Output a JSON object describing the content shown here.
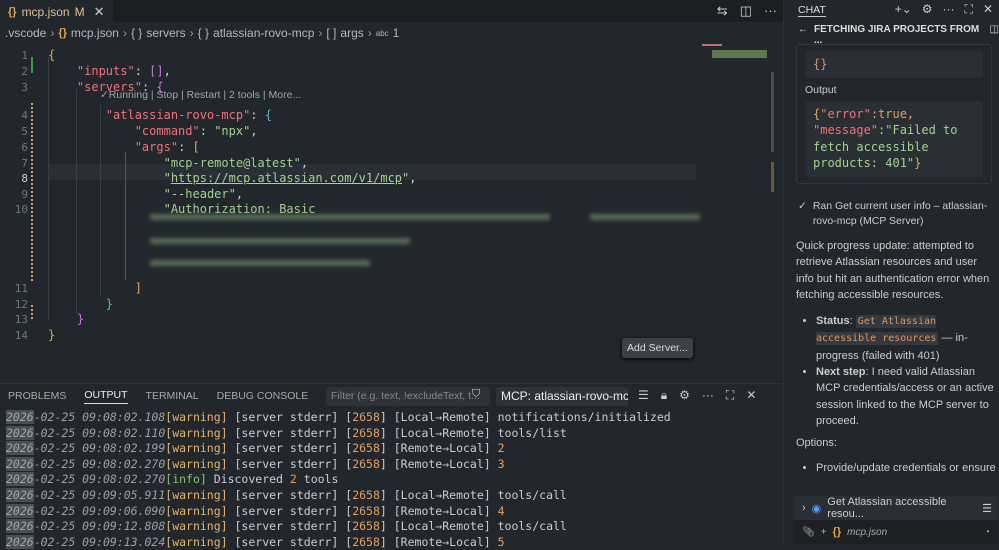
{
  "editor": {
    "tab": {
      "name": "mcp.json",
      "status": "M"
    },
    "breadcrumb": [
      ".vscode",
      "mcp.json",
      "servers",
      "atlassian-rovo-mcp",
      "args",
      "1"
    ],
    "codelens": "✓Running | Stop | Restart | 2 tools | More...",
    "lines": [
      {
        "n": "1",
        "tokens": [
          {
            "t": "{",
            "c": "b1"
          }
        ]
      },
      {
        "n": "2",
        "tokens": [
          {
            "t": "    "
          },
          {
            "t": "\"inputs\"",
            "c": "k"
          },
          {
            "t": ": ",
            "c": "p"
          },
          {
            "t": "[]",
            "c": "b2"
          },
          {
            "t": ",",
            "c": "p"
          }
        ]
      },
      {
        "n": "3",
        "tokens": [
          {
            "t": "    "
          },
          {
            "t": "\"servers\"",
            "c": "k"
          },
          {
            "t": ": ",
            "c": "p"
          },
          {
            "t": "{",
            "c": "b2"
          }
        ]
      },
      {
        "n": "4",
        "tokens": [
          {
            "t": "        "
          },
          {
            "t": "\"atlassian-rovo-mcp\"",
            "c": "k"
          },
          {
            "t": ": ",
            "c": "p"
          },
          {
            "t": "{",
            "c": "b3"
          }
        ]
      },
      {
        "n": "5",
        "tokens": [
          {
            "t": "            "
          },
          {
            "t": "\"command\"",
            "c": "k"
          },
          {
            "t": ": ",
            "c": "p"
          },
          {
            "t": "\"npx\"",
            "c": "s"
          },
          {
            "t": ",",
            "c": "p"
          }
        ]
      },
      {
        "n": "6",
        "tokens": [
          {
            "t": "            "
          },
          {
            "t": "\"args\"",
            "c": "k"
          },
          {
            "t": ": ",
            "c": "p"
          },
          {
            "t": "[",
            "c": "b1"
          }
        ]
      },
      {
        "n": "7",
        "tokens": [
          {
            "t": "                "
          },
          {
            "t": "\"mcp-remote@latest\"",
            "c": "s"
          },
          {
            "t": ",",
            "c": "p"
          }
        ]
      },
      {
        "n": "8",
        "tokens": [
          {
            "t": "                "
          },
          {
            "t": "\"",
            "c": "s"
          },
          {
            "t": "https://mcp.atlassian.com/v1/mcp",
            "c": "u"
          },
          {
            "t": "\"",
            "c": "s"
          },
          {
            "t": ",",
            "c": "p"
          }
        ]
      },
      {
        "n": "9",
        "tokens": [
          {
            "t": "                "
          },
          {
            "t": "\"--header\"",
            "c": "s"
          },
          {
            "t": ",",
            "c": "p"
          }
        ]
      },
      {
        "n": "10",
        "tokens": [
          {
            "t": "                "
          },
          {
            "t": "\"Authorization: Basic",
            "c": "s"
          }
        ]
      },
      {
        "n": "11",
        "tokens": [
          {
            "t": "            "
          },
          {
            "t": "]",
            "c": "b1"
          }
        ]
      },
      {
        "n": "12",
        "tokens": [
          {
            "t": "        "
          },
          {
            "t": "}",
            "c": "b3"
          }
        ]
      },
      {
        "n": "13",
        "tokens": [
          {
            "t": "    "
          },
          {
            "t": "}",
            "c": "b2"
          }
        ]
      },
      {
        "n": "14",
        "tokens": [
          {
            "t": "}",
            "c": "b1"
          }
        ]
      }
    ],
    "add_server": "Add Server..."
  },
  "panel": {
    "tabs": [
      "PROBLEMS",
      "OUTPUT",
      "TERMINAL",
      "DEBUG CONSOLE"
    ],
    "active_tab": "OUTPUT",
    "filter_placeholder": "Filter (e.g. text, !excludeText, t...",
    "channel": "MCP: atlassian-rovo-mcp",
    "log": [
      {
        "year": "2026",
        "ts": "-02-25 09:08:02.108",
        "lvl": "[warning]",
        "src": " [server stderr] [",
        "pid": "2658",
        "dir": "] [Local→Remote] ",
        "msg": "notifications/initialized"
      },
      {
        "year": "2026",
        "ts": "-02-25 09:08:02.110",
        "lvl": "[warning]",
        "src": " [server stderr] [",
        "pid": "2658",
        "dir": "] [Local→Remote] ",
        "msg": "tools/list"
      },
      {
        "year": "2026",
        "ts": "-02-25 09:08:02.199",
        "lvl": "[warning]",
        "src": " [server stderr] [",
        "pid": "2658",
        "dir": "] [Remote→Local] ",
        "msg": "2"
      },
      {
        "year": "2026",
        "ts": "-02-25 09:08:02.270",
        "lvl": "[warning]",
        "src": " [server stderr] [",
        "pid": "2658",
        "dir": "] [Remote→Local] ",
        "msg": "3"
      },
      {
        "year": "2026",
        "ts": "-02-25 09:08:02.270",
        "lvl": "[info]",
        "src": " Discovered ",
        "pid": "2",
        "dir": " tools",
        "msg": ""
      },
      {
        "year": "2026",
        "ts": "-02-25 09:09:05.911",
        "lvl": "[warning]",
        "src": " [server stderr] [",
        "pid": "2658",
        "dir": "] [Local→Remote] ",
        "msg": "tools/call"
      },
      {
        "year": "2026",
        "ts": "-02-25 09:09:06.090",
        "lvl": "[warning]",
        "src": " [server stderr] [",
        "pid": "2658",
        "dir": "] [Remote→Local] ",
        "msg": "4"
      },
      {
        "year": "2026",
        "ts": "-02-25 09:09:12.808",
        "lvl": "[warning]",
        "src": " [server stderr] [",
        "pid": "2658",
        "dir": "] [Local→Remote] ",
        "msg": "tools/call"
      },
      {
        "year": "2026",
        "ts": "-02-25 09:09:13.024",
        "lvl": "[warning]",
        "src": " [server stderr] [",
        "pid": "2658",
        "dir": "] [Remote→Local] ",
        "msg": "5"
      }
    ]
  },
  "chat": {
    "header": "CHAT",
    "conversation_title": "FETCHING JIRA PROJECTS FROM ...",
    "input_block": "{}",
    "output_label": "Output",
    "output": {
      "k1": "\"error\"",
      "v1": ":true,",
      "k2": "\"message\"",
      "v2": ":\"Failed to fetch accessible products: 401\"",
      "end": "}"
    },
    "ran": "Ran Get current user info – atlassian-rovo-mcp (MCP Server)",
    "progress": "Quick progress update: attempted to retrieve Atlassian resources and user info but hit an authentication error when fetching accessible resources.",
    "status_label": "Status",
    "status_code": "Get Atlassian accessible resources",
    "status_rest": " — in-progress (failed with 401)",
    "next_label": "Next step",
    "next_rest": ": I need valid Atlassian MCP credentials/access or an active session linked to the MCP server to proceed.",
    "options_label": "Options:",
    "option1": "Provide/update credentials or ensure",
    "todo": "Get Atlassian accessible resou...",
    "attachment": "mcp.json"
  }
}
